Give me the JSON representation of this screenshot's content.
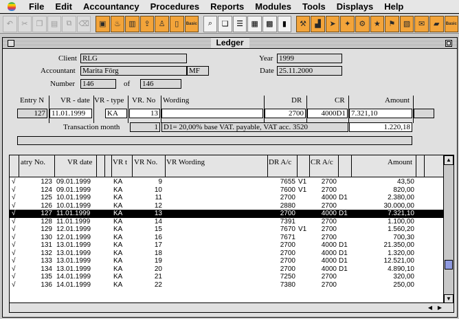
{
  "menubar": {
    "items": [
      "File",
      "Edit",
      "Accountancy",
      "Procedures",
      "Reports",
      "Modules",
      "Tools",
      "Displays",
      "Help"
    ]
  },
  "toolbar": {
    "icons": [
      "undo-icon",
      "cut-icon",
      "copy-icon",
      "paste-icon",
      "duplicate-icon",
      "clear-icon",
      "new-entry-icon",
      "fire-icon",
      "ledger-icon",
      "export-icon",
      "person-icon",
      "document-icon",
      "basic-icon",
      "search-icon",
      "windows-icon",
      "list-icon",
      "calculator-icon",
      "grid-icon",
      "book-icon",
      "basic-tools-icon",
      "chart-icon",
      "run-icon",
      "run2-icon",
      "tools-icon",
      "star-icon",
      "flag-icon",
      "clipboard-icon",
      "mail-icon",
      "folder-icon",
      "basic-icon-2"
    ],
    "basic_label": "Basic"
  },
  "window": {
    "title": "Ledger"
  },
  "form": {
    "client_label": "Client",
    "client_value": "RLG",
    "accountant_label": "Accountant",
    "accountant_value": "Marita Förg",
    "accountant_code": "MF",
    "number_label": "Number",
    "number_value": "146",
    "of_label": "of",
    "of_value": "146",
    "year_label": "Year",
    "year_value": "1999",
    "date_label": "Date",
    "date_value": "25.11.2000"
  },
  "entry": {
    "headers": {
      "entry_n": "Entry N",
      "vr_date": "VR - date",
      "vr_type": "VR - type",
      "vr_no": "VR. No",
      "wording": "Wording",
      "dr": "DR",
      "cr": "CR",
      "amount": "Amount"
    },
    "values": {
      "entry_n": "127",
      "vr_date": "11.01.1999",
      "vr_type": "KA",
      "vr_no": "13",
      "wording": "",
      "dr": "2700",
      "cr": "4000D1",
      "amount": "7.321,10"
    },
    "transaction_month_label": "Transaction month",
    "transaction_month_value": "1",
    "vat_note": "D1= 20,00% base  VAT. payable, VAT acc. 3520",
    "vat_amount": "1.220,18"
  },
  "table": {
    "headers": {
      "entry_no": "atry No.",
      "vr_date": "VR date",
      "vr_t": "VR t",
      "vr_no": "VR No.",
      "vr_wording": "VR Wording",
      "dr": "DR A/c",
      "cr": "CR A/c",
      "amount": "Amount"
    },
    "rows": [
      {
        "check": "√",
        "no": "123",
        "date": "09.01.1999",
        "t": "KA",
        "vr": "9",
        "wording": "",
        "dr": "7655",
        "drf": "V1",
        "cr": "2700",
        "crf": "",
        "amount": "43,50",
        "selected": false
      },
      {
        "check": "√",
        "no": "124",
        "date": "09.01.1999",
        "t": "KA",
        "vr": "10",
        "wording": "",
        "dr": "7600",
        "drf": "V1",
        "cr": "2700",
        "crf": "",
        "amount": "820,00",
        "selected": false
      },
      {
        "check": "√",
        "no": "125",
        "date": "10.01.1999",
        "t": "KA",
        "vr": "11",
        "wording": "",
        "dr": "2700",
        "drf": "",
        "cr": "4000",
        "crf": "D1",
        "amount": "2.380,00",
        "selected": false
      },
      {
        "check": "√",
        "no": "126",
        "date": "10.01.1999",
        "t": "KA",
        "vr": "12",
        "wording": "",
        "dr": "2880",
        "drf": "",
        "cr": "2700",
        "crf": "",
        "amount": "30.000,00",
        "selected": false
      },
      {
        "check": "√",
        "no": "127",
        "date": "11.01.1999",
        "t": "KA",
        "vr": "13",
        "wording": "",
        "dr": "2700",
        "drf": "",
        "cr": "4000",
        "crf": "D1",
        "amount": "7.321,10",
        "selected": true
      },
      {
        "check": "√",
        "no": "128",
        "date": "11.01.1999",
        "t": "KA",
        "vr": "14",
        "wording": "",
        "dr": "7391",
        "drf": "",
        "cr": "2700",
        "crf": "",
        "amount": "1.100,00",
        "selected": false
      },
      {
        "check": "√",
        "no": "129",
        "date": "12.01.1999",
        "t": "KA",
        "vr": "15",
        "wording": "",
        "dr": "7670",
        "drf": "V1",
        "cr": "2700",
        "crf": "",
        "amount": "1.560,20",
        "selected": false
      },
      {
        "check": "√",
        "no": "130",
        "date": "12.01.1999",
        "t": "KA",
        "vr": "16",
        "wording": "",
        "dr": "7671",
        "drf": "",
        "cr": "2700",
        "crf": "",
        "amount": "700,30",
        "selected": false
      },
      {
        "check": "√",
        "no": "131",
        "date": "13.01.1999",
        "t": "KA",
        "vr": "17",
        "wording": "",
        "dr": "2700",
        "drf": "",
        "cr": "4000",
        "crf": "D1",
        "amount": "21.350,00",
        "selected": false
      },
      {
        "check": "√",
        "no": "132",
        "date": "13.01.1999",
        "t": "KA",
        "vr": "18",
        "wording": "",
        "dr": "2700",
        "drf": "",
        "cr": "4000",
        "crf": "D1",
        "amount": "1.320,00",
        "selected": false
      },
      {
        "check": "√",
        "no": "133",
        "date": "13.01.1999",
        "t": "KA",
        "vr": "19",
        "wording": "",
        "dr": "2700",
        "drf": "",
        "cr": "4000",
        "crf": "D1",
        "amount": "12.521,00",
        "selected": false
      },
      {
        "check": "√",
        "no": "134",
        "date": "13.01.1999",
        "t": "KA",
        "vr": "20",
        "wording": "",
        "dr": "2700",
        "drf": "",
        "cr": "4000",
        "crf": "D1",
        "amount": "4.890,10",
        "selected": false
      },
      {
        "check": "√",
        "no": "135",
        "date": "14.01.1999",
        "t": "KA",
        "vr": "21",
        "wording": "",
        "dr": "7250",
        "drf": "",
        "cr": "2700",
        "crf": "",
        "amount": "320,00",
        "selected": false
      },
      {
        "check": "√",
        "no": "136",
        "date": "14.01.1999",
        "t": "KA",
        "vr": "22",
        "wording": "",
        "dr": "7380",
        "drf": "",
        "cr": "2700",
        "crf": "",
        "amount": "250,00",
        "selected": false
      }
    ]
  }
}
